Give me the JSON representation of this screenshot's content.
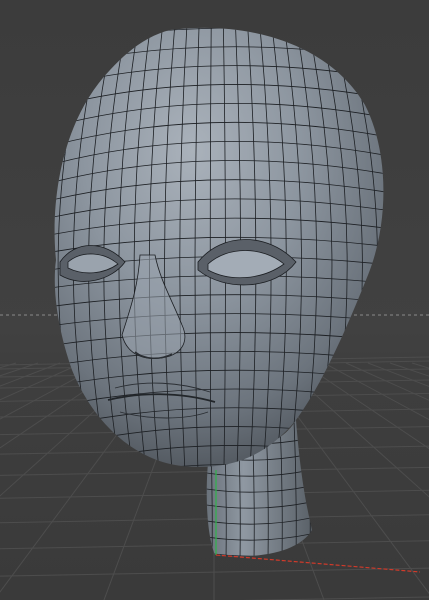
{
  "viewport": {
    "type": "3d-perspective",
    "background_color": "#3f3f3f",
    "grid_color": "#4d4d4d",
    "horizon_color": "#8a8a8a",
    "x_axis_color": "#d23a2a",
    "y_axis_color": "#2fb24a"
  },
  "model": {
    "name": "head",
    "display_mode": "shaded-wireframe",
    "surface_color": "#8c959f",
    "wire_color": "#1c1f23"
  }
}
